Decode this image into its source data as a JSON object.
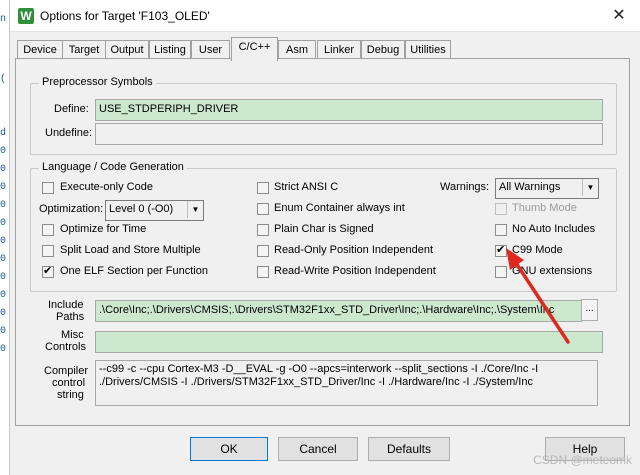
{
  "window": {
    "title": "Options for Target 'F103_OLED'",
    "close": "✕"
  },
  "tabs": [
    "Device",
    "Target",
    "Output",
    "Listing",
    "User",
    "C/C++",
    "Asm",
    "Linker",
    "Debug",
    "Utilities"
  ],
  "active_tab": "C/C++",
  "preprocessor": {
    "group_title": "Preprocessor Symbols",
    "define_label": "Define:",
    "define_value": "USE_STDPERIPH_DRIVER",
    "undefine_label": "Undefine:",
    "undefine_value": ""
  },
  "codegen": {
    "group_title": "Language / Code Generation",
    "execute_only": {
      "label": "Execute-only Code",
      "checked": false
    },
    "optimization_label": "Optimization:",
    "optimization_value": "Level 0 (-O0)",
    "optimize_time": {
      "label": "Optimize for Time",
      "checked": false
    },
    "split_load": {
      "label": "Split Load and Store Multiple",
      "checked": false
    },
    "one_elf": {
      "label": "One ELF Section per Function",
      "checked": true
    },
    "strict_ansi": {
      "label": "Strict ANSI C",
      "checked": false
    },
    "enum_container": {
      "label": "Enum Container always int",
      "checked": false
    },
    "plain_char": {
      "label": "Plain Char is Signed",
      "checked": false
    },
    "ro_position": {
      "label": "Read-Only Position Independent",
      "checked": false
    },
    "rw_position": {
      "label": "Read-Write Position Independent",
      "checked": false
    },
    "warnings_label": "Warnings:",
    "warnings_value": "All Warnings",
    "thumb_mode": {
      "label": "Thumb Mode",
      "checked": false,
      "disabled": true
    },
    "no_auto_includes": {
      "label": "No Auto Includes",
      "checked": false
    },
    "c99_mode": {
      "label": "C99 Mode",
      "checked": true
    },
    "gnu_extensions": {
      "label": "GNU extensions",
      "checked": false
    }
  },
  "include_paths": {
    "label_line1": "Include",
    "label_line2": "Paths",
    "value": ".\\Core\\Inc;.\\Drivers\\CMSIS;.\\Drivers\\STM32F1xx_STD_Driver\\Inc;.\\Hardware\\Inc;.\\System\\Inc",
    "browse": "..."
  },
  "misc_controls": {
    "label_line1": "Misc",
    "label_line2": "Controls",
    "value": ""
  },
  "compiler_string": {
    "label_line1": "Compiler",
    "label_line2": "control",
    "label_line3": "string",
    "line1": "--c99 -c --cpu Cortex-M3 -D__EVAL -g -O0 --apcs=interwork --split_sections -I ./Core/Inc -I",
    "line2": "./Drivers/CMSIS -I ./Drivers/STM32F1xx_STD_Driver/Inc -I ./Hardware/Inc -I ./System/Inc"
  },
  "buttons": {
    "ok": "OK",
    "cancel": "Cancel",
    "defaults": "Defaults",
    "help": "Help"
  },
  "watermark": "CSDN @meteomk",
  "colors": {
    "accent_field": "#cce8cf",
    "arrow": "#e0291e",
    "app_icon": "#2f8f3a"
  }
}
